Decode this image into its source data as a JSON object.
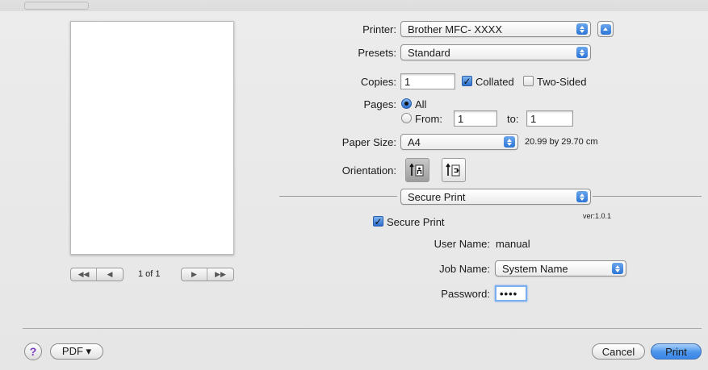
{
  "preview": {
    "page_counter": "1 of 1",
    "nav_icons": [
      "first-page-icon",
      "previous-page-icon",
      "next-page-icon",
      "last-page-icon"
    ]
  },
  "printer": {
    "label": "Printer:",
    "value": "Brother MFC- XXXX"
  },
  "presets": {
    "label": "Presets:",
    "value": "Standard"
  },
  "copies": {
    "label": "Copies:",
    "value": "1",
    "collated_label": "Collated",
    "collated_checked": true,
    "two_sided_label": "Two-Sided",
    "two_sided_checked": false
  },
  "pages": {
    "label": "Pages:",
    "all_label": "All",
    "all_selected": true,
    "from_label": "From:",
    "from_value": "1",
    "to_label": "to:",
    "to_value": "1"
  },
  "paper_size": {
    "label": "Paper Size:",
    "value": "A4",
    "dimensions": "20.99 by 29.70 cm"
  },
  "orientation": {
    "label": "Orientation:",
    "options": [
      "portrait-icon",
      "landscape-icon"
    ],
    "selected": "portrait"
  },
  "section": {
    "value": "Secure Print",
    "version": "ver:1.0.1"
  },
  "secure_print": {
    "checkbox_label": "Secure Print",
    "checked": true,
    "user_name_label": "User Name:",
    "user_name_value": "manual",
    "job_name_label": "Job Name:",
    "job_name_value": "System Name",
    "password_label": "Password:",
    "password_value": "••••"
  },
  "footer": {
    "help_symbol": "?",
    "pdf_label": "PDF ▾",
    "cancel_label": "Cancel",
    "print_label": "Print"
  },
  "colors": {
    "accent": "#3a86e6",
    "help": "#7a3bc2"
  }
}
